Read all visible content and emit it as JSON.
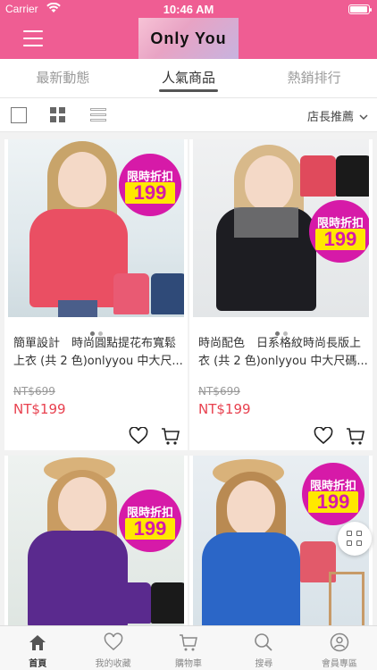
{
  "status": {
    "carrier": "Carrier",
    "time": "10:46 AM"
  },
  "header": {
    "logo_text": "Only You"
  },
  "tabs": [
    {
      "label": "最新動態"
    },
    {
      "label": "人氣商品"
    },
    {
      "label": "熱銷排行"
    }
  ],
  "toolbar": {
    "sort_label": "店長推薦"
  },
  "badge": {
    "top": "限時折扣",
    "value": "199"
  },
  "products": [
    {
      "title": "簡單設計　時尚圓點提花布寬鬆上衣 (共 2 色)onlyyou 中大尺...",
      "old_price": "NT$699",
      "price": "NT$199"
    },
    {
      "title": "時尚配色　日系格紋時尚長版上衣 (共 2 色)onlyyou 中大尺碼...",
      "old_price": "NT$699",
      "price": "NT$199"
    },
    {
      "title": "",
      "old_price": "",
      "price": ""
    },
    {
      "title": "",
      "old_price": "",
      "price": ""
    }
  ],
  "bottom_nav": [
    {
      "label": "首頁",
      "icon": "home-icon"
    },
    {
      "label": "我的收藏",
      "icon": "heart-icon"
    },
    {
      "label": "購物車",
      "icon": "cart-icon"
    },
    {
      "label": "搜尋",
      "icon": "search-icon"
    },
    {
      "label": "會員專區",
      "icon": "user-icon"
    }
  ],
  "colors": {
    "brand": "#ef5d93",
    "badge": "#d61aa8",
    "price": "#e8414f"
  }
}
